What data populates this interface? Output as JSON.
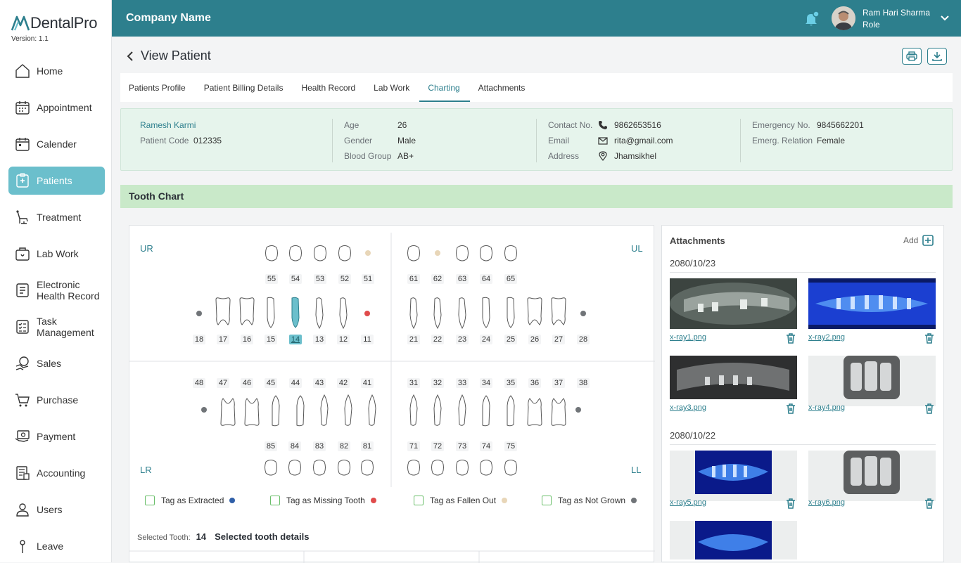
{
  "app": {
    "name": "DentalPro",
    "version": "Version: 1.1",
    "brand_color": "#2d7f8d",
    "accent_color": "#6bbfcc"
  },
  "sidebar": {
    "items": [
      {
        "label": "Home",
        "icon": "home-icon"
      },
      {
        "label": "Appointment",
        "icon": "calendar-icon"
      },
      {
        "label": "Calender",
        "icon": "calendar-grid-icon"
      },
      {
        "label": "Patients",
        "icon": "patients-icon",
        "active": true
      },
      {
        "label": "Treatment",
        "icon": "dental-chair-icon"
      },
      {
        "label": "Lab Work",
        "icon": "lab-icon"
      },
      {
        "label": "Electronic Health Record",
        "icon": "health-record-icon"
      },
      {
        "label": "Task Management",
        "icon": "task-icon"
      },
      {
        "label": "Sales",
        "icon": "sales-icon"
      },
      {
        "label": "Purchase",
        "icon": "cart-icon"
      },
      {
        "label": "Payment",
        "icon": "payment-icon"
      },
      {
        "label": "Accounting",
        "icon": "accounting-icon"
      },
      {
        "label": "Users",
        "icon": "user-icon"
      },
      {
        "label": "Leave",
        "icon": "leave-icon"
      }
    ]
  },
  "header": {
    "company": "Company Name",
    "user_name": "Ram Hari Sharma",
    "user_role": "Role"
  },
  "page": {
    "title": "View Patient"
  },
  "tabs": [
    {
      "label": "Patients Profile"
    },
    {
      "label": "Patient Billing Details"
    },
    {
      "label": "Health Record"
    },
    {
      "label": "Lab Work"
    },
    {
      "label": "Charting",
      "active": true
    },
    {
      "label": "Attachments"
    }
  ],
  "patient": {
    "name": "Ramesh Karmi",
    "code_label": "Patient Code",
    "code": "012335",
    "age_label": "Age",
    "age": "26",
    "gender_label": "Gender",
    "gender": "Male",
    "blood_label": "Blood Group",
    "blood": "AB+",
    "contact_label": "Contact No.",
    "contact": "9862653516",
    "email_label": "Email",
    "email": "rita@gmail.com",
    "address_label": "Address",
    "address": "Jhamsikhel",
    "emergency_label": "Emergency No.",
    "emergency": "9845662201",
    "relation_label": "Emerg. Relation",
    "relation": "Female"
  },
  "tooth_chart": {
    "title": "Tooth Chart",
    "quadrants": {
      "ur": "UR",
      "ul": "UL",
      "lr": "LR",
      "ll": "LL"
    },
    "upper_primary_right": [
      "55",
      "54",
      "53",
      "52",
      "51"
    ],
    "upper_primary_left": [
      "61",
      "62",
      "63",
      "64",
      "65"
    ],
    "upper_permanent_right": [
      "18",
      "17",
      "16",
      "15",
      "14",
      "13",
      "12",
      "11"
    ],
    "upper_permanent_left": [
      "21",
      "22",
      "23",
      "24",
      "25",
      "26",
      "27",
      "28"
    ],
    "lower_permanent_right": [
      "48",
      "47",
      "46",
      "45",
      "44",
      "43",
      "42",
      "41"
    ],
    "lower_permanent_left": [
      "31",
      "32",
      "33",
      "34",
      "35",
      "36",
      "37",
      "38"
    ],
    "lower_primary_right": [
      "85",
      "84",
      "83",
      "82",
      "81"
    ],
    "lower_primary_left": [
      "71",
      "72",
      "73",
      "74",
      "75"
    ],
    "tags": [
      {
        "label": "Tag as Extracted",
        "color": "#2f5fa8"
      },
      {
        "label": "Tag as Missing Tooth",
        "color": "#e04b4b"
      },
      {
        "label": "Tag as Fallen Out",
        "color": "#e8d6b8"
      },
      {
        "label": "Tag as Not Grown",
        "color": "#707478"
      }
    ],
    "selected_label": "Selected Tooth:",
    "selected_tooth": "14",
    "selected_details": "Selected tooth details"
  },
  "attachments": {
    "title": "Attachments",
    "add_label": "Add",
    "groups": [
      {
        "date": "2080/10/23",
        "files": [
          "x-ray1.png",
          "x-ray2.png",
          "x-ray3.png",
          "x-ray4.png"
        ]
      },
      {
        "date": "2080/10/22",
        "files": [
          "x-ray5.png",
          "x-ray6.png"
        ]
      }
    ]
  }
}
